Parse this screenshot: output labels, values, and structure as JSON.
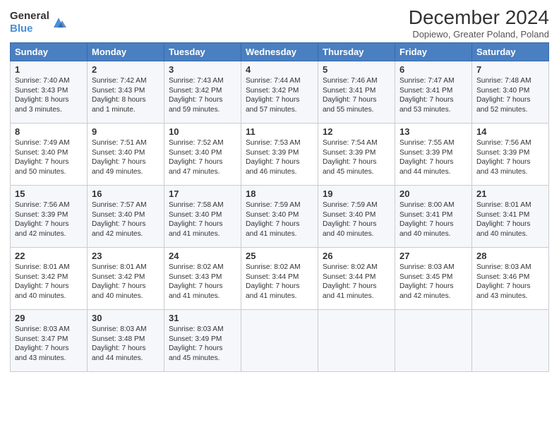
{
  "header": {
    "logo_general": "General",
    "logo_blue": "Blue",
    "title": "December 2024",
    "subtitle": "Dopiewo, Greater Poland, Poland"
  },
  "days_of_week": [
    "Sunday",
    "Monday",
    "Tuesday",
    "Wednesday",
    "Thursday",
    "Friday",
    "Saturday"
  ],
  "weeks": [
    [
      {
        "day": 1,
        "sunrise": "Sunrise: 7:40 AM",
        "sunset": "Sunset: 3:43 PM",
        "daylight": "Daylight: 8 hours and 3 minutes."
      },
      {
        "day": 2,
        "sunrise": "Sunrise: 7:42 AM",
        "sunset": "Sunset: 3:43 PM",
        "daylight": "Daylight: 8 hours and 1 minute."
      },
      {
        "day": 3,
        "sunrise": "Sunrise: 7:43 AM",
        "sunset": "Sunset: 3:42 PM",
        "daylight": "Daylight: 7 hours and 59 minutes."
      },
      {
        "day": 4,
        "sunrise": "Sunrise: 7:44 AM",
        "sunset": "Sunset: 3:42 PM",
        "daylight": "Daylight: 7 hours and 57 minutes."
      },
      {
        "day": 5,
        "sunrise": "Sunrise: 7:46 AM",
        "sunset": "Sunset: 3:41 PM",
        "daylight": "Daylight: 7 hours and 55 minutes."
      },
      {
        "day": 6,
        "sunrise": "Sunrise: 7:47 AM",
        "sunset": "Sunset: 3:41 PM",
        "daylight": "Daylight: 7 hours and 53 minutes."
      },
      {
        "day": 7,
        "sunrise": "Sunrise: 7:48 AM",
        "sunset": "Sunset: 3:40 PM",
        "daylight": "Daylight: 7 hours and 52 minutes."
      }
    ],
    [
      {
        "day": 8,
        "sunrise": "Sunrise: 7:49 AM",
        "sunset": "Sunset: 3:40 PM",
        "daylight": "Daylight: 7 hours and 50 minutes."
      },
      {
        "day": 9,
        "sunrise": "Sunrise: 7:51 AM",
        "sunset": "Sunset: 3:40 PM",
        "daylight": "Daylight: 7 hours and 49 minutes."
      },
      {
        "day": 10,
        "sunrise": "Sunrise: 7:52 AM",
        "sunset": "Sunset: 3:40 PM",
        "daylight": "Daylight: 7 hours and 47 minutes."
      },
      {
        "day": 11,
        "sunrise": "Sunrise: 7:53 AM",
        "sunset": "Sunset: 3:39 PM",
        "daylight": "Daylight: 7 hours and 46 minutes."
      },
      {
        "day": 12,
        "sunrise": "Sunrise: 7:54 AM",
        "sunset": "Sunset: 3:39 PM",
        "daylight": "Daylight: 7 hours and 45 minutes."
      },
      {
        "day": 13,
        "sunrise": "Sunrise: 7:55 AM",
        "sunset": "Sunset: 3:39 PM",
        "daylight": "Daylight: 7 hours and 44 minutes."
      },
      {
        "day": 14,
        "sunrise": "Sunrise: 7:56 AM",
        "sunset": "Sunset: 3:39 PM",
        "daylight": "Daylight: 7 hours and 43 minutes."
      }
    ],
    [
      {
        "day": 15,
        "sunrise": "Sunrise: 7:56 AM",
        "sunset": "Sunset: 3:39 PM",
        "daylight": "Daylight: 7 hours and 42 minutes."
      },
      {
        "day": 16,
        "sunrise": "Sunrise: 7:57 AM",
        "sunset": "Sunset: 3:40 PM",
        "daylight": "Daylight: 7 hours and 42 minutes."
      },
      {
        "day": 17,
        "sunrise": "Sunrise: 7:58 AM",
        "sunset": "Sunset: 3:40 PM",
        "daylight": "Daylight: 7 hours and 41 minutes."
      },
      {
        "day": 18,
        "sunrise": "Sunrise: 7:59 AM",
        "sunset": "Sunset: 3:40 PM",
        "daylight": "Daylight: 7 hours and 41 minutes."
      },
      {
        "day": 19,
        "sunrise": "Sunrise: 7:59 AM",
        "sunset": "Sunset: 3:40 PM",
        "daylight": "Daylight: 7 hours and 40 minutes."
      },
      {
        "day": 20,
        "sunrise": "Sunrise: 8:00 AM",
        "sunset": "Sunset: 3:41 PM",
        "daylight": "Daylight: 7 hours and 40 minutes."
      },
      {
        "day": 21,
        "sunrise": "Sunrise: 8:01 AM",
        "sunset": "Sunset: 3:41 PM",
        "daylight": "Daylight: 7 hours and 40 minutes."
      }
    ],
    [
      {
        "day": 22,
        "sunrise": "Sunrise: 8:01 AM",
        "sunset": "Sunset: 3:42 PM",
        "daylight": "Daylight: 7 hours and 40 minutes."
      },
      {
        "day": 23,
        "sunrise": "Sunrise: 8:01 AM",
        "sunset": "Sunset: 3:42 PM",
        "daylight": "Daylight: 7 hours and 40 minutes."
      },
      {
        "day": 24,
        "sunrise": "Sunrise: 8:02 AM",
        "sunset": "Sunset: 3:43 PM",
        "daylight": "Daylight: 7 hours and 41 minutes."
      },
      {
        "day": 25,
        "sunrise": "Sunrise: 8:02 AM",
        "sunset": "Sunset: 3:44 PM",
        "daylight": "Daylight: 7 hours and 41 minutes."
      },
      {
        "day": 26,
        "sunrise": "Sunrise: 8:02 AM",
        "sunset": "Sunset: 3:44 PM",
        "daylight": "Daylight: 7 hours and 41 minutes."
      },
      {
        "day": 27,
        "sunrise": "Sunrise: 8:03 AM",
        "sunset": "Sunset: 3:45 PM",
        "daylight": "Daylight: 7 hours and 42 minutes."
      },
      {
        "day": 28,
        "sunrise": "Sunrise: 8:03 AM",
        "sunset": "Sunset: 3:46 PM",
        "daylight": "Daylight: 7 hours and 43 minutes."
      }
    ],
    [
      {
        "day": 29,
        "sunrise": "Sunrise: 8:03 AM",
        "sunset": "Sunset: 3:47 PM",
        "daylight": "Daylight: 7 hours and 43 minutes."
      },
      {
        "day": 30,
        "sunrise": "Sunrise: 8:03 AM",
        "sunset": "Sunset: 3:48 PM",
        "daylight": "Daylight: 7 hours and 44 minutes."
      },
      {
        "day": 31,
        "sunrise": "Sunrise: 8:03 AM",
        "sunset": "Sunset: 3:49 PM",
        "daylight": "Daylight: 7 hours and 45 minutes."
      },
      null,
      null,
      null,
      null
    ]
  ]
}
